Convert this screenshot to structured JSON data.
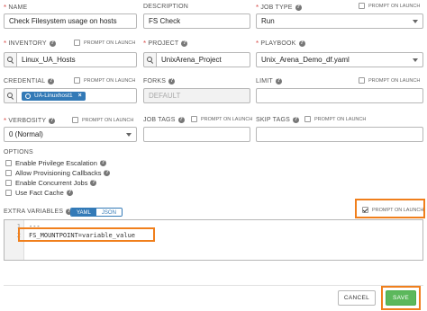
{
  "form": {
    "name": {
      "label": "NAME",
      "value": "Check Filesystem usage on hosts"
    },
    "description": {
      "label": "DESCRIPTION",
      "value": "FS Check"
    },
    "job_type": {
      "label": "JOB TYPE",
      "value": "Run",
      "prompt_on_launch": "PROMPT ON LAUNCH"
    },
    "inventory": {
      "label": "INVENTORY",
      "value": "Linux_UA_Hosts",
      "prompt_on_launch": "PROMPT ON LAUNCH"
    },
    "project": {
      "label": "PROJECT",
      "value": "UnixArena_Project"
    },
    "playbook": {
      "label": "PLAYBOOK",
      "value": "Unix_Arena_Demo_df.yaml"
    },
    "credential": {
      "label": "CREDENTIAL",
      "tag": "UA-Linuxhost1",
      "prompt_on_launch": "PROMPT ON LAUNCH"
    },
    "forks": {
      "label": "FORKS",
      "placeholder": "DEFAULT"
    },
    "limit": {
      "label": "LIMIT",
      "prompt_on_launch": "PROMPT ON LAUNCH"
    },
    "verbosity": {
      "label": "VERBOSITY",
      "value": "0 (Normal)",
      "prompt_on_launch": "PROMPT ON LAUNCH"
    },
    "job_tags": {
      "label": "JOB TAGS",
      "prompt_on_launch": "PROMPT ON LAUNCH"
    },
    "skip_tags": {
      "label": "SKIP TAGS",
      "prompt_on_launch": "PROMPT ON LAUNCH"
    },
    "options": {
      "label": "OPTIONS",
      "items": [
        {
          "label": "Enable Privilege Escalation"
        },
        {
          "label": "Allow Provisioning Callbacks"
        },
        {
          "label": "Enable Concurrent Jobs"
        },
        {
          "label": "Use Fact Cache"
        }
      ]
    },
    "extra_variables": {
      "label": "EXTRA VARIABLES",
      "toggle": [
        "YAML",
        "JSON"
      ],
      "prompt_on_launch": "PROMPT ON LAUNCH",
      "lines": [
        {
          "num": "1",
          "text": "---"
        },
        {
          "num": "2",
          "text": "FS_MOUNTPOINT=variable_value"
        }
      ]
    }
  },
  "actions": {
    "cancel": "CANCEL",
    "save": "SAVE"
  },
  "colors": {
    "accent": "#337ab7",
    "save": "#5cb85c",
    "highlight": "#f07f1c",
    "required": "#d9534f"
  }
}
